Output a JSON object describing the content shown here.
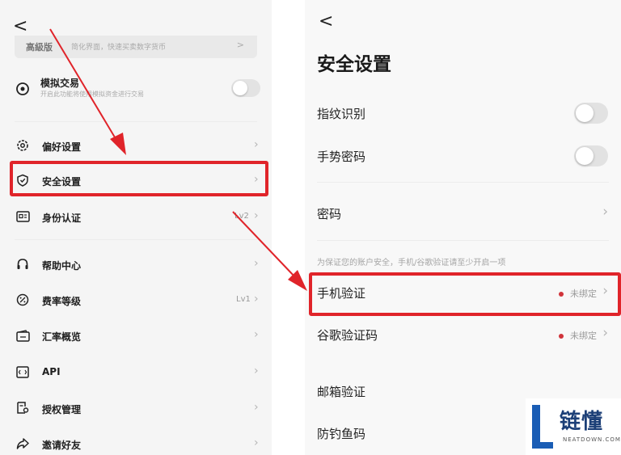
{
  "left": {
    "back": "<",
    "banner_title": "高級版",
    "banner_sub": "简化界面，快速买卖数字货币",
    "banner_arrow": ">",
    "sim": {
      "title": "模拟交易",
      "subtitle": "开启此功能将使用模拟资金进行交易"
    },
    "items": [
      {
        "label": "偏好设置",
        "icon": "gear-icon",
        "right": ""
      },
      {
        "label": "安全设置",
        "icon": "shield-icon",
        "right": ""
      },
      {
        "label": "身份认证",
        "icon": "id-card-icon",
        "right": "Lv2"
      },
      {
        "label": "帮助中心",
        "icon": "headset-icon",
        "right": ""
      },
      {
        "label": "费率等级",
        "icon": "percent-icon",
        "right": "Lv1"
      },
      {
        "label": "汇率概览",
        "icon": "wallet-icon",
        "right": ""
      },
      {
        "label": "API",
        "icon": "api-icon",
        "right": ""
      },
      {
        "label": "授权管理",
        "icon": "authorization-icon",
        "right": ""
      },
      {
        "label": "邀请好友",
        "icon": "share-icon",
        "right": ""
      }
    ]
  },
  "right": {
    "back": "<",
    "title": "安全设置",
    "fingerprint": "指纹识别",
    "gesture": "手势密码",
    "password": "密码",
    "notice": "为保证您的账户安全，手机/谷歌验证请至少开启一项",
    "phone": {
      "label": "手机验证",
      "status": "未绑定"
    },
    "google": {
      "label": "谷歌验证码",
      "status": "未绑定"
    },
    "email": "邮箱验证",
    "antiphish": "防钓鱼码"
  },
  "watermark": {
    "brand": "链懂",
    "site": "NEATDOWN.COM"
  },
  "colors": {
    "highlight": "#e0242a",
    "dot": "#d0343b"
  }
}
